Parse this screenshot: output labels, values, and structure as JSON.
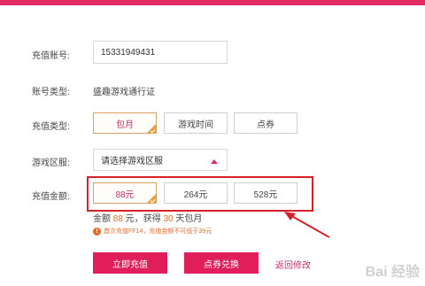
{
  "form": {
    "account_label": "充值账号:",
    "account_value": "15331949431",
    "account_type_label": "账号类型:",
    "account_type_value": "盛趣游戏通行证",
    "recharge_type_label": "充值类型:",
    "recharge_types": [
      "包月",
      "游戏时间",
      "点券"
    ],
    "recharge_type_selected": "包月",
    "zone_label": "游戏区服:",
    "zone_placeholder": "请选择游戏区服",
    "amount_label": "充值金额:",
    "amounts": [
      "88元",
      "264元",
      "528元"
    ],
    "amount_selected": "88元"
  },
  "summary": {
    "prefix": "金额 ",
    "amount": "88",
    "mid1": " 元，获得 ",
    "days": "30",
    "suffix": " 天包月"
  },
  "notice": {
    "icon": "!",
    "text": "首次充值FF14，充值金额不可低于39元"
  },
  "actions": {
    "pay_now": "立即充值",
    "coupon_exchange": "点券兑换",
    "back": "返回修改"
  },
  "watermark": "Bai 经验",
  "colors": {
    "brand": "#e01e5a",
    "selected_border": "#d9a066",
    "corner_badge": "#e8a33c",
    "annotation": "#d6202a",
    "highlight_text": "#e46a2e"
  }
}
